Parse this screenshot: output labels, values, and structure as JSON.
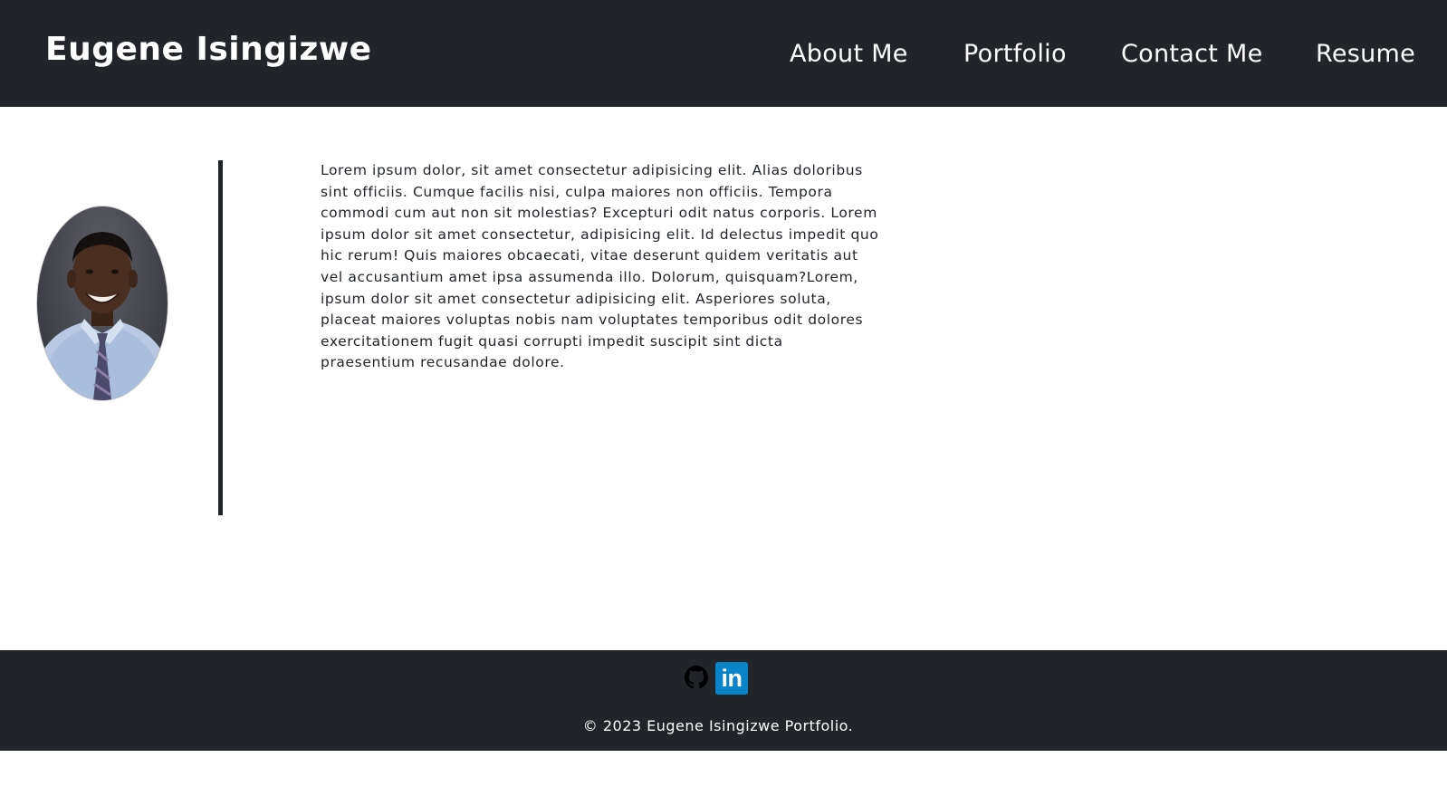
{
  "header": {
    "brand": "Eugene Isingizwe",
    "nav": [
      {
        "label": "About Me"
      },
      {
        "label": "Portfolio"
      },
      {
        "label": "Contact Me"
      },
      {
        "label": "Resume"
      }
    ]
  },
  "about": {
    "bio": "Lorem ipsum dolor, sit amet consectetur adipisicing elit. Alias doloribus sint officiis. Cumque facilis nisi, culpa maiores non officiis. Tempora commodi cum aut non sit molestias? Excepturi odit natus corporis. Lorem ipsum dolor sit amet consectetur, adipisicing elit. Id delectus impedit quo hic rerum! Quis maiores obcaecati, vitae deserunt quidem veritatis aut vel accusantium amet ipsa assumenda illo. Dolorum, quisquam?Lorem, ipsum dolor sit amet consectetur adipisicing elit. Asperiores soluta, placeat maiores voluptas nobis nam voluptates temporibus odit dolores exercitationem fugit quasi corrupti impedit suscipit sint dicta praesentium recusandae dolore."
  },
  "footer": {
    "social": [
      {
        "icon": "github-icon"
      },
      {
        "icon": "linkedin-icon",
        "glyph": "in",
        "color": "#0a84c9"
      }
    ],
    "copyright": "© 2023 Eugene Isingizwe Portfolio."
  },
  "colors": {
    "dark": "#212529",
    "accent": "#0a84c9"
  }
}
